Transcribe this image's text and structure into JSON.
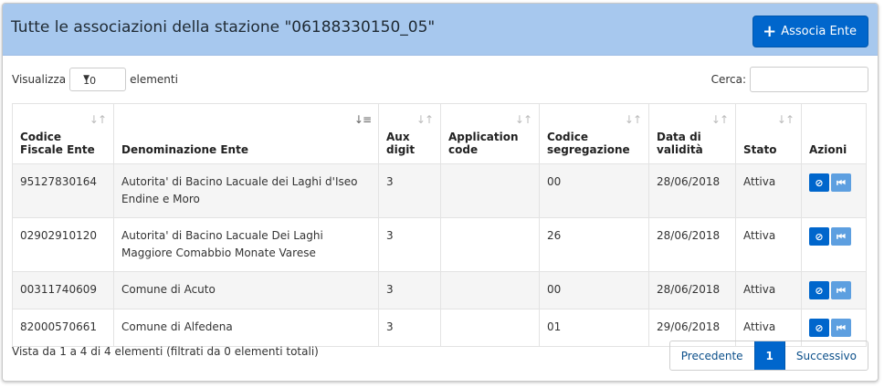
{
  "header": {
    "title": "Tutte le associazioni della stazione \"06188330150_05\"",
    "add_button": "Associa Ente"
  },
  "controls": {
    "show_prefix": "Visualizza",
    "show_value": "10",
    "show_suffix": "elementi",
    "search_label": "Cerca:"
  },
  "table": {
    "columns": [
      {
        "line1": "Codice",
        "line2": "Fiscale Ente"
      },
      {
        "line1": "",
        "line2": "Denominazione Ente"
      },
      {
        "line1": "Aux",
        "line2": "digit"
      },
      {
        "line1": "Application",
        "line2": "code"
      },
      {
        "line1": "Codice",
        "line2": "segregazione"
      },
      {
        "line1": "Data di",
        "line2": "validità"
      },
      {
        "line1": "",
        "line2": "Stato"
      },
      {
        "line1": "",
        "line2": "Azioni"
      }
    ],
    "rows": [
      {
        "cf": "95127830164",
        "name": "Autorita' di Bacino Lacuale dei Laghi d'Iseo Endine e Moro",
        "aux": "3",
        "app": "",
        "seg": "00",
        "date": "28/06/2018",
        "stato": "Attiva"
      },
      {
        "cf": "02902910120",
        "name": "Autorita' di Bacino Lacuale Dei Laghi Maggiore Comabbio Monate Varese",
        "aux": "3",
        "app": "",
        "seg": "26",
        "date": "28/06/2018",
        "stato": "Attiva"
      },
      {
        "cf": "00311740609",
        "name": "Comune di Acuto",
        "aux": "3",
        "app": "",
        "seg": "00",
        "date": "28/06/2018",
        "stato": "Attiva"
      },
      {
        "cf": "82000570661",
        "name": "Comune di Alfedena",
        "aux": "3",
        "app": "",
        "seg": "01",
        "date": "29/06/2018",
        "stato": "Attiva"
      }
    ]
  },
  "footer": {
    "info": "Vista da 1 a 4 di 4 elementi (filtrati da 0 elementi totali)",
    "prev": "Precedente",
    "page": "1",
    "next": "Successivo"
  },
  "icons": {
    "add": "plus-icon",
    "sort": "sort-icon",
    "disable": "ban-icon",
    "step": "skip-back-icon"
  },
  "colors": {
    "header_bg": "#a7c8ee",
    "primary": "#0066cc",
    "secondary_action": "#5d9fe0"
  }
}
